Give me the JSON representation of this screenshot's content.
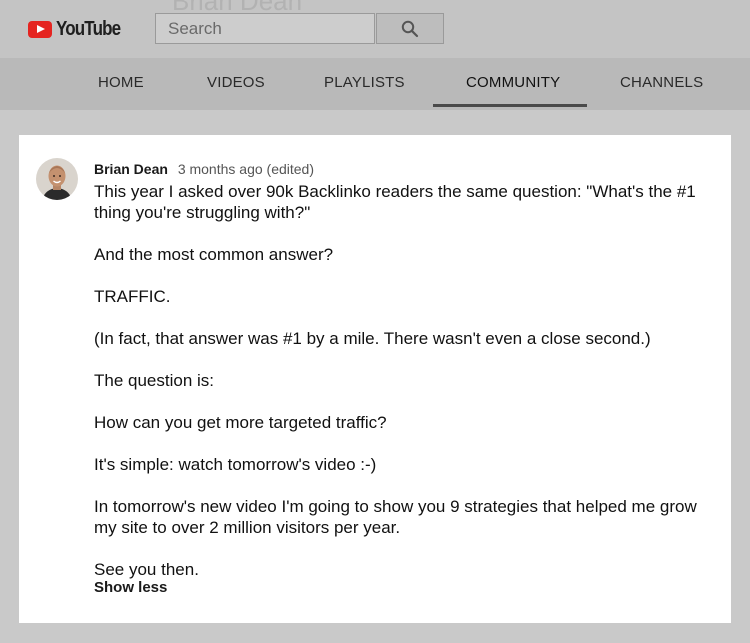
{
  "header": {
    "channel_name_ghost": "Brian Dean",
    "logo_text": "YouTube",
    "search": {
      "placeholder": "Search",
      "value": ""
    }
  },
  "tabs": [
    {
      "label": "HOME",
      "active": false
    },
    {
      "label": "VIDEOS",
      "active": false
    },
    {
      "label": "PLAYLISTS",
      "active": false
    },
    {
      "label": "COMMUNITY",
      "active": true
    },
    {
      "label": "CHANNELS",
      "active": false
    }
  ],
  "post": {
    "author": "Brian Dean",
    "time": "3 months ago (edited)",
    "paragraphs": [
      "This year I asked over 90k Backlinko readers the same question:  \"What's the #1 thing you're struggling with?\"",
      "And the most common answer?",
      "TRAFFIC.",
      "(In fact, that answer was #1 by a mile. There wasn't even a close second.)",
      "The question is:",
      "How can you get more targeted traffic?",
      "It's simple: watch tomorrow's video :-)",
      "In tomorrow's new video I'm going to show you 9 strategies that helped me grow my site to over 2 million visitors per year.",
      "See you then."
    ],
    "show_less_label": "Show less"
  },
  "colors": {
    "logo_red": "#e52420",
    "page_dim": "#c9c9c9",
    "card_bg": "#ffffff"
  },
  "icons": {
    "logo": "youtube-play-icon",
    "search": "search-icon",
    "avatar": "avatar-image"
  }
}
